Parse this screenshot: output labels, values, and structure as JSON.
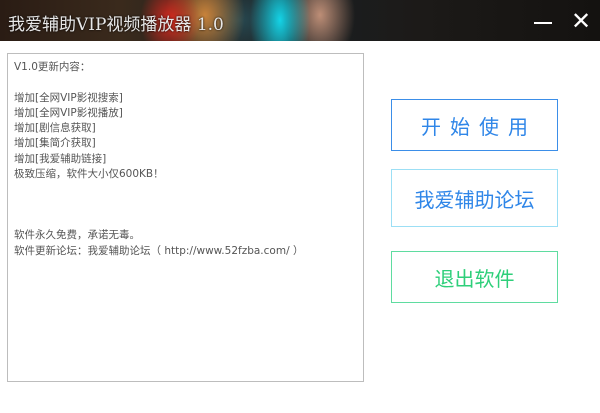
{
  "window": {
    "title": "我爱辅助VIP视频播放器 1.0",
    "minimize_icon": "minimize-icon",
    "close_icon": "close-icon"
  },
  "changelog": {
    "lines": [
      "V1.0更新内容：",
      "",
      "增加[全网VIP影视搜索]",
      "增加[全网VIP影视播放]",
      "增加[剧信息获取]",
      "增加[集简介获取]",
      "增加[我爱辅助链接]",
      "极致压缩，软件大小仅600KB！",
      "",
      "",
      "",
      "软件永久免费，承诺无毒。",
      "软件更新论坛：我爱辅助论坛（ http://www.52fzba.com/ ）"
    ]
  },
  "buttons": {
    "start": "开始使用",
    "forum": "我爱辅助论坛",
    "exit": "退出软件"
  },
  "colors": {
    "start": "#2f86e8",
    "forum_border": "#9cdff5",
    "exit": "#2ecf7a"
  }
}
